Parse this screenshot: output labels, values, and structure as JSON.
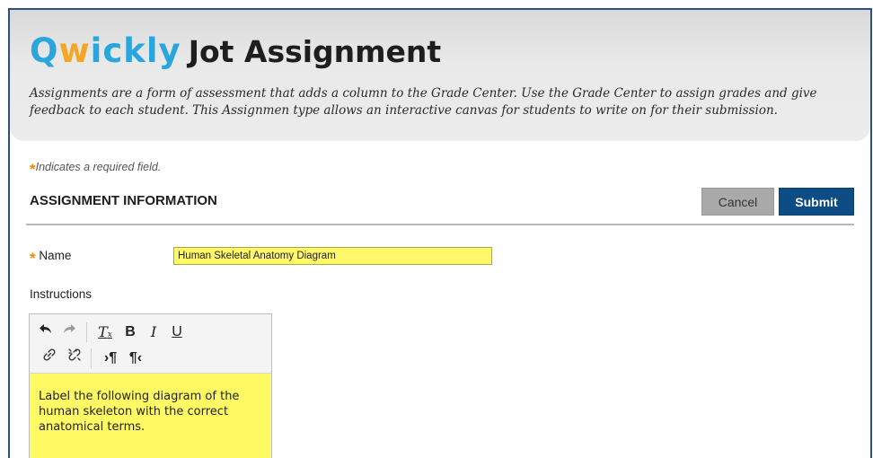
{
  "header": {
    "brand_q": "Q",
    "brand_w": "w",
    "brand_rest": "ickly",
    "title": "Jot Assignment",
    "description": "Assignments are a form of assessment that adds a column to the Grade Center. Use the Grade Center to assign grades and give feedback to each student. This Assignmen type allows an interactive canvas for students to write on for their submission."
  },
  "required_note": "Indicates a required field.",
  "section": {
    "title": "ASSIGNMENT INFORMATION",
    "cancel_label": "Cancel",
    "submit_label": "Submit"
  },
  "form": {
    "name_label": "Name",
    "name_value": "Human Skeletal Anatomy Diagram",
    "instructions_label": "Instructions",
    "instructions_text": "Label the following diagram of the human skeleton with the correct anatomical terms."
  },
  "toolbar": {
    "icons": [
      "undo-icon",
      "redo-icon",
      "clear-format-icon",
      "bold-icon",
      "italic-icon",
      "underline-icon",
      "link-icon",
      "unlink-icon",
      "ltr-icon",
      "rtl-icon"
    ]
  },
  "colors": {
    "brand_blue": "#2aa6df",
    "brand_orange": "#f5a623",
    "submit_bg": "#0d4c85",
    "highlight_yellow": "#fff964",
    "required_star": "#f08a00"
  }
}
